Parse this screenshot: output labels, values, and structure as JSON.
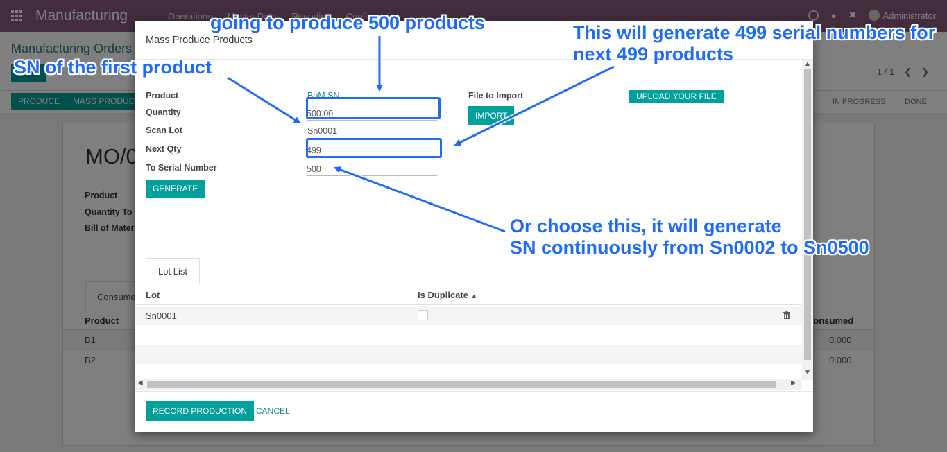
{
  "app": {
    "title": "Manufacturing",
    "menu": [
      "Operations",
      "Master Data",
      "Reporting",
      "Configuration"
    ],
    "user": "Administrator"
  },
  "background": {
    "breadcrumb": "Manufacturing Orders /",
    "pager": "1 / 1",
    "buttons": [
      "PRODUCE",
      "MASS PRODUCE"
    ],
    "stages": [
      "IN PROGRESS",
      "DONE"
    ],
    "record_name": "MO/0",
    "field_labels": [
      "Product",
      "Quantity To P",
      "Bill of Mater"
    ],
    "tab_label": "Consume",
    "col_product": "Product",
    "col_consumed": "Consumed",
    "rows": [
      {
        "product": "B1",
        "consumed": "0.000"
      },
      {
        "product": "B2",
        "consumed": "0.000"
      }
    ]
  },
  "modal": {
    "title": "Mass Produce Products",
    "labels": {
      "product": "Product",
      "quantity": "Quantity",
      "scan_lot": "Scan Lot",
      "next_qty": "Next Qty",
      "to_serial": "To Serial Number",
      "file_import": "File to Import"
    },
    "values": {
      "product": "BoM SN",
      "quantity": "500.00",
      "scan_lot": "Sn0001",
      "next_qty": "499",
      "to_serial": "500"
    },
    "upload_button": "UPLOAD YOUR FILE",
    "import_button": "IMPORT",
    "generate_button": "GENERATE",
    "tab": "Lot List",
    "columns": {
      "lot": "Lot",
      "duplicate": "Is Duplicate"
    },
    "lots": [
      {
        "lot": "Sn0001",
        "is_duplicate": false
      }
    ],
    "record_button": "RECORD PRODUCTION",
    "cancel_button": "CANCEL"
  },
  "annotations": {
    "produce": "going to produce 500 products",
    "first_sn": "SN of the first product",
    "next_line1": "This will generate 499 serial numbers for",
    "next_line2": "next 499 products",
    "cont_line1": "Or choose this, it will generate",
    "cont_line2": "SN continuously from Sn0002 to Sn0500"
  },
  "colors": {
    "brand": "#875a7b",
    "primary": "#00a09d",
    "annotation": "#1e6cf5"
  }
}
